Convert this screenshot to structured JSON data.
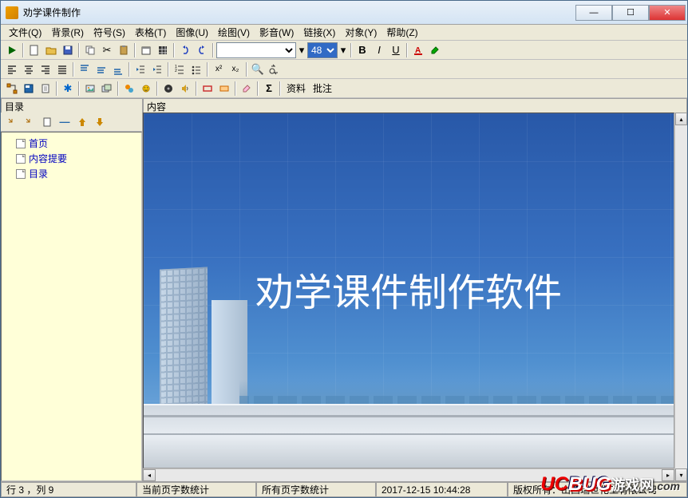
{
  "window": {
    "title": "劝学课件制作"
  },
  "menu": {
    "file": "文件(Q)",
    "background": "背景(R)",
    "symbol": "符号(S)",
    "table": "表格(T)",
    "image": "图像(U)",
    "draw": "绘图(V)",
    "media": "影音(W)",
    "link": "链接(X)",
    "object": "对象(Y)",
    "help": "帮助(Z)"
  },
  "toolbar1": {
    "font_value": "",
    "size_value": "48",
    "bold": "B",
    "italic": "I",
    "underline": "U"
  },
  "toolbar3": {
    "material": "资料",
    "annotate": "批注",
    "sigma": "Σ"
  },
  "left": {
    "header": "目录",
    "tree": {
      "item1": "首页",
      "item2": "内容提要",
      "item3": "目录"
    }
  },
  "right": {
    "header": "内容"
  },
  "slide": {
    "title": "劝学课件制作软件"
  },
  "status": {
    "position": "行 3 ，列 9",
    "current_page": "当前页字数统计",
    "all_pages": "所有页字数统计",
    "datetime": "2017-12-15 10:44:28",
    "copyright": "版权所有：山西瑞世化工有限公司"
  },
  "watermark": {
    "uc": "UC",
    "bug": "BUG",
    "cn": "游戏网",
    "com": ".com"
  }
}
